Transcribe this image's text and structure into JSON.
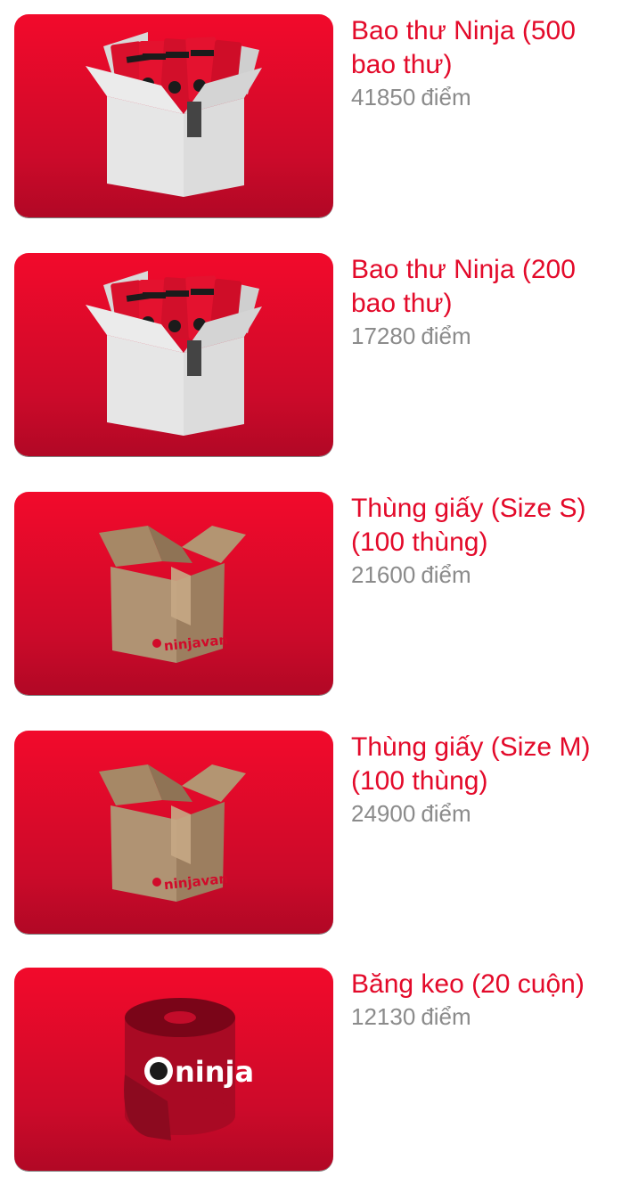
{
  "rewards": [
    {
      "title": "Bao thư Ninja (500 bao thư)",
      "points": "41850",
      "unit": "điểm",
      "image_icon": "envelope-box-icon"
    },
    {
      "title": "Bao thư Ninja (200 bao thư)",
      "points": "17280",
      "unit": "điểm",
      "image_icon": "envelope-box-icon"
    },
    {
      "title": "Thùng giấy (Size S) (100 thùng)",
      "points": "21600",
      "unit": "điểm",
      "image_icon": "cardboard-box-icon"
    },
    {
      "title": "Thùng giấy (Size M) (100 thùng)",
      "points": "24900",
      "unit": "điểm",
      "image_icon": "cardboard-box-icon"
    },
    {
      "title": "Băng keo (20 cuộn)",
      "points": "12130",
      "unit": "điểm",
      "image_icon": "tape-roll-icon"
    }
  ],
  "box_brand_text": "ninjavan",
  "tape_brand_text": "ninja",
  "colors": {
    "accent": "#e30a2a",
    "muted": "#8b8b8b",
    "card_red": "#e0092b"
  }
}
